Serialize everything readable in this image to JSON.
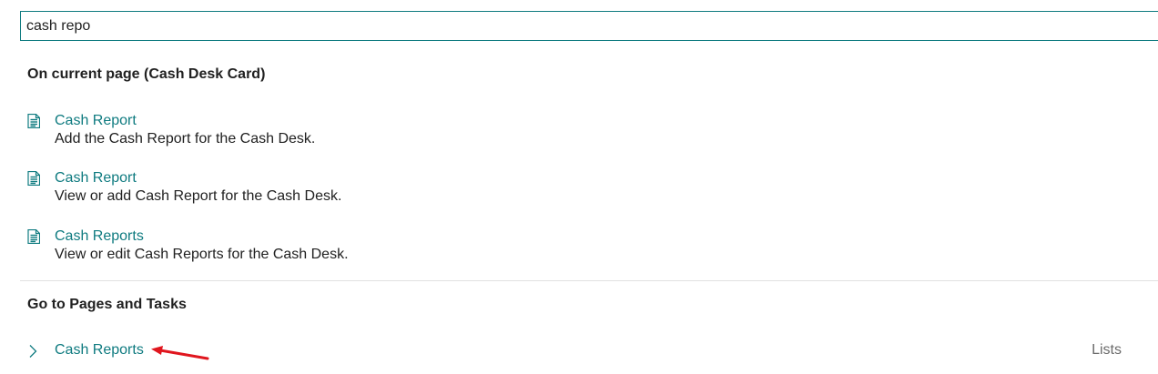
{
  "search": {
    "value": "cash repo"
  },
  "current_page_section": {
    "heading": "On current page (Cash Desk Card)",
    "results": [
      {
        "title": "Cash Report",
        "description": "Add the Cash Report for the Cash Desk.",
        "icon": "document-icon"
      },
      {
        "title": "Cash Report",
        "description": "View or add Cash Report for the Cash Desk.",
        "icon": "document-icon"
      },
      {
        "title": "Cash Reports",
        "description": "View or edit Cash Reports for the Cash Desk.",
        "icon": "document-icon"
      }
    ]
  },
  "pages_tasks_section": {
    "heading": "Go to Pages and Tasks",
    "results": [
      {
        "title": "Cash Reports",
        "category": "Lists",
        "icon": "chevron-right-icon"
      }
    ]
  },
  "colors": {
    "accent": "#0f7b80",
    "annotation_arrow": "#e0161e"
  }
}
